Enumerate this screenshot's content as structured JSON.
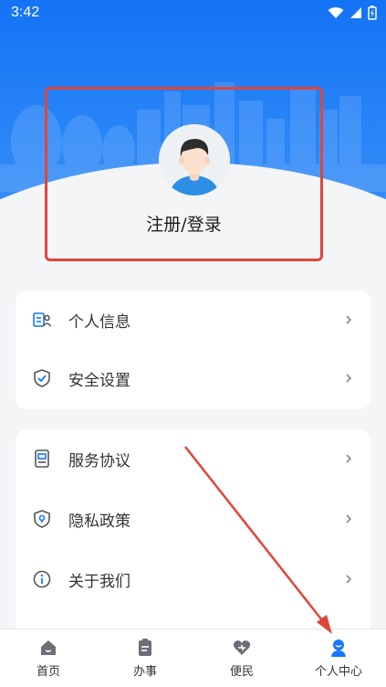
{
  "status_bar": {
    "time": "3:42"
  },
  "profile": {
    "login_label": "注册/登录"
  },
  "menu_group_1": [
    {
      "label": "个人信息",
      "icon": "id-card-icon"
    },
    {
      "label": "安全设置",
      "icon": "shield-check-icon"
    }
  ],
  "menu_group_2": [
    {
      "label": "服务协议",
      "icon": "document-icon"
    },
    {
      "label": "隐私政策",
      "icon": "privacy-shield-icon"
    },
    {
      "label": "关于我们",
      "icon": "info-icon"
    }
  ],
  "tabbar": [
    {
      "label": "首页",
      "icon": "home-icon"
    },
    {
      "label": "办事",
      "icon": "clipboard-icon"
    },
    {
      "label": "便民",
      "icon": "heart-icon"
    },
    {
      "label": "个人中心",
      "icon": "user-icon",
      "active": true
    }
  ],
  "colors": {
    "primary": "#1473f5",
    "active_tab": "#1677ff",
    "annotation": "#e0453a"
  }
}
